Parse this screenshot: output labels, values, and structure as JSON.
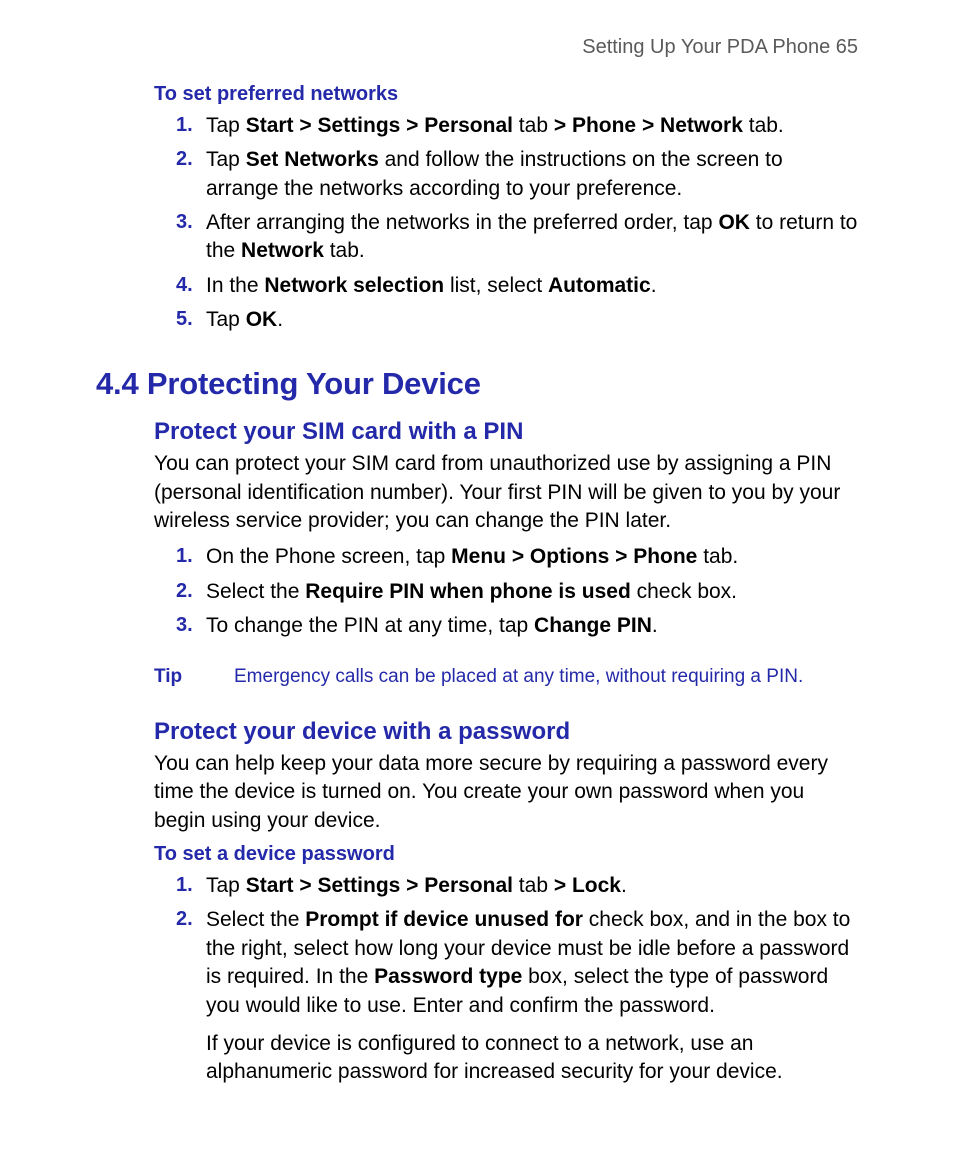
{
  "header": {
    "running": "Setting Up Your PDA Phone  65"
  },
  "sec1": {
    "heading": "To set preferred networks",
    "items": {
      "i1": {
        "a": "Tap ",
        "b": "Start > Settings > Personal",
        "c": " tab ",
        "d": "> Phone > Network",
        "e": " tab."
      },
      "i2": {
        "a": "Tap ",
        "b": "Set Networks",
        "c": " and follow the instructions on the screen to arrange the networks according to your preference."
      },
      "i3": {
        "a": "After arranging the networks in the preferred order, tap ",
        "b": "OK",
        "c": " to return to the ",
        "d": "Network",
        "e": " tab."
      },
      "i4": {
        "a": "In the ",
        "b": "Network selection",
        "c": " list, select ",
        "d": "Automatic",
        "e": "."
      },
      "i5": {
        "a": "Tap ",
        "b": "OK",
        "c": "."
      }
    }
  },
  "title": "4.4 Protecting Your Device",
  "sec2": {
    "heading": "Protect your SIM card with a PIN",
    "intro": "You can protect your SIM card from unauthorized use by assigning a PIN (personal identification number). Your first PIN will be given to you by your wireless service provider; you can change the PIN later.",
    "items": {
      "i1": {
        "a": "On the Phone screen, tap ",
        "b": "Menu > Options > Phone",
        "c": " tab."
      },
      "i2": {
        "a": "Select the ",
        "b": "Require PIN when phone is used",
        "c": " check box."
      },
      "i3": {
        "a": "To change the PIN at any time, tap ",
        "b": "Change PIN",
        "c": "."
      }
    },
    "tip": {
      "label": "Tip",
      "body": "Emergency calls can be placed at any time, without requiring a PIN."
    }
  },
  "sec3": {
    "heading": "Protect your device with a password",
    "intro": "You can help keep your data more secure by requiring a password every time the device is turned on. You create your own password when you begin using your device.",
    "sub": "To set a device password",
    "items": {
      "i1": {
        "a": "Tap ",
        "b": "Start > Settings > Personal",
        "c": " tab ",
        "d": "> Lock",
        "e": "."
      },
      "i2": {
        "a": "Select the ",
        "b": "Prompt if device unused for",
        "c": " check box, and in the box to the right, select how long your device must be idle before a password is required. In the ",
        "d": "Password type",
        "e": " box, select the type of password you would like to use. Enter and confirm the password.",
        "extra": "If your device is configured to connect to a network, use an alphanumeric password for increased security for your device."
      }
    }
  },
  "nums": {
    "n1": "1.",
    "n2": "2.",
    "n3": "3.",
    "n4": "4.",
    "n5": "5."
  }
}
